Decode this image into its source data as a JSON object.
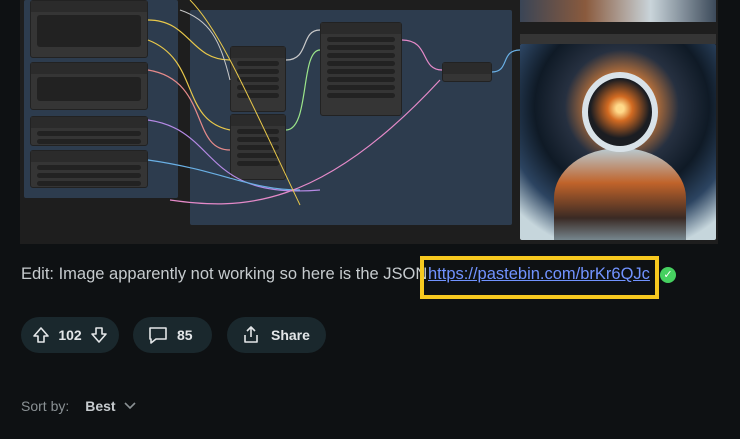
{
  "post": {
    "edit_text": "Edit: Image apparently not working so here is the JSON",
    "link_text": "https://pastebin.com/brKr6QJc",
    "verified_icon": "check-circle-icon",
    "highlight_color": "#f7c91f",
    "link_color": "#7193ff"
  },
  "actions": {
    "upvote_icon": "arrow-up-icon",
    "vote_count": "102",
    "downvote_icon": "arrow-down-icon",
    "comment_icon": "comment-bubble-icon",
    "comment_count": "85",
    "share_icon": "share-icon",
    "share_label": "Share"
  },
  "sort": {
    "label": "Sort by:",
    "value": "Best",
    "icon": "chevron-down-icon"
  },
  "screenshot": {
    "description_icon": "comfyui-node-graph-image"
  }
}
